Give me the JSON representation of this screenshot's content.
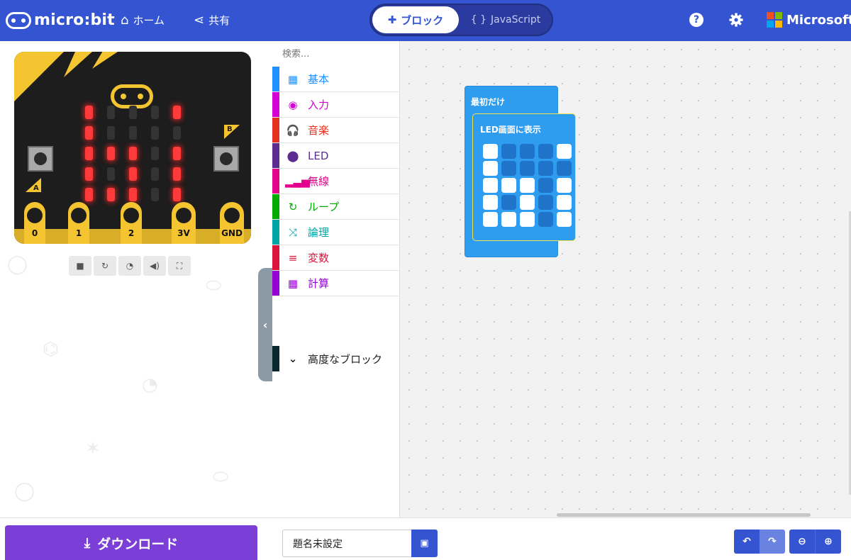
{
  "header": {
    "brand": "micro:bit",
    "home_label": "ホーム",
    "share_label": "共有",
    "mode_blocks": "ブロック",
    "mode_js": "JavaScript",
    "mode_js_prefix": "{ }",
    "microsoft": "Microsoft",
    "help_glyph": "?"
  },
  "simulator": {
    "led_pattern": [
      [
        1,
        0,
        0,
        0,
        1
      ],
      [
        1,
        0,
        0,
        0,
        0
      ],
      [
        1,
        1,
        1,
        0,
        1
      ],
      [
        1,
        0,
        1,
        0,
        1
      ],
      [
        1,
        1,
        1,
        0,
        1
      ]
    ],
    "button_a": "A",
    "button_b": "B",
    "pins": [
      "0",
      "1",
      "2",
      "3V",
      "GND"
    ],
    "controls": [
      "stop-icon",
      "restart-icon",
      "slowmo-icon",
      "sound-icon",
      "fullscreen-icon"
    ]
  },
  "toolbox": {
    "search_placeholder": "検索...",
    "categories": [
      {
        "label": "基本",
        "color": "#1e90ff",
        "icon": "grid-icon",
        "glyph": "▦"
      },
      {
        "label": "入力",
        "color": "#d400d4",
        "icon": "target-icon",
        "glyph": "◉"
      },
      {
        "label": "音楽",
        "color": "#e63022",
        "icon": "headphones-icon",
        "glyph": "🎧"
      },
      {
        "label": "LED",
        "color": "#5c2d91",
        "icon": "toggle-icon",
        "glyph": "⬤"
      },
      {
        "label": "無線",
        "color": "#e3008c",
        "icon": "signal-icon",
        "glyph": "▂▃▅"
      },
      {
        "label": "ループ",
        "color": "#00aa00",
        "icon": "loop-icon",
        "glyph": "↻"
      },
      {
        "label": "論理",
        "color": "#00a4a6",
        "icon": "shuffle-icon",
        "glyph": "⤨"
      },
      {
        "label": "変数",
        "color": "#dc143c",
        "icon": "lines-icon",
        "glyph": "≡"
      },
      {
        "label": "計算",
        "color": "#9400d3",
        "icon": "calculator-icon",
        "glyph": "▦"
      }
    ],
    "advanced_label": "高度なブロック"
  },
  "workspace": {
    "block_on_start": "最初だけ",
    "block_show_leds": "LED画面に表示",
    "show_leds_pattern": [
      [
        1,
        0,
        0,
        0,
        1
      ],
      [
        1,
        0,
        0,
        0,
        0
      ],
      [
        1,
        1,
        1,
        0,
        1
      ],
      [
        1,
        0,
        1,
        0,
        1
      ],
      [
        1,
        1,
        1,
        0,
        1
      ]
    ]
  },
  "footer": {
    "download_label": "ダウンロード",
    "project_name": "題名未設定"
  }
}
